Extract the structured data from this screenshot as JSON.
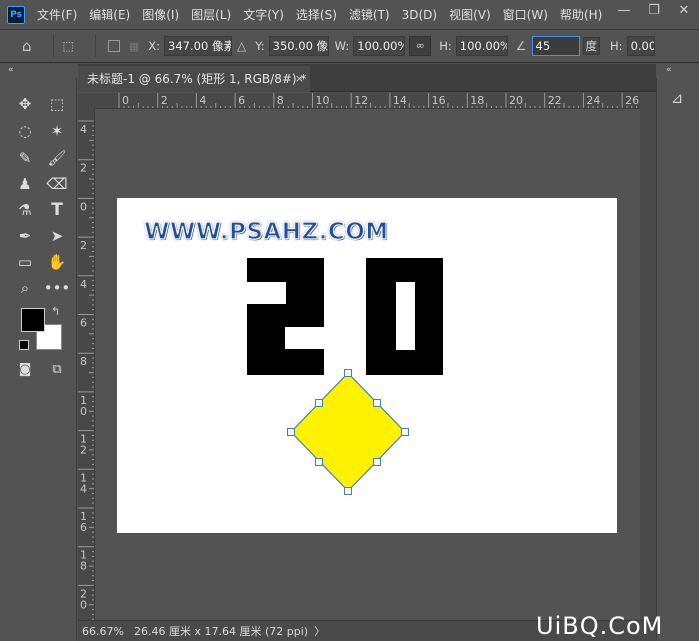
{
  "app": {
    "logo": "Ps"
  },
  "menu": [
    "文件(F)",
    "编辑(E)",
    "图像(I)",
    "图层(L)",
    "文字(Y)",
    "选择(S)",
    "滤镜(T)",
    "3D(D)",
    "视图(V)",
    "窗口(W)",
    "帮助(H)"
  ],
  "window_controls": {
    "minimize": "—",
    "restore": "❐",
    "close": "✕"
  },
  "options": {
    "x_label": "X:",
    "x_value": "347.00 像素",
    "y_label": "Y:",
    "y_value": "350.00 像素",
    "w_label": "W:",
    "w_value": "100.00%",
    "h_label": "H:",
    "h_value": "100.00%",
    "angle_value": "45",
    "angle_unit": "度",
    "h2_label": "H:",
    "h2_value": "0.00"
  },
  "panels": {
    "collapse_left": "«",
    "collapse_right": "«"
  },
  "document_tab": {
    "title": "未标题-1 @ 66.7% (矩形 1, RGB/8#) *",
    "close": "×"
  },
  "ruler_top": [
    "0",
    "2",
    "4",
    "6",
    "8",
    "10",
    "12",
    "14",
    "16",
    "18",
    "20",
    "22",
    "24",
    "26"
  ],
  "ruler_left": [
    "4",
    "2",
    "0",
    "2",
    "4",
    "6",
    "8",
    "10",
    "12",
    "14",
    "16",
    "18",
    "20"
  ],
  "canvas": {
    "watermark": "WWW.PSAHZ.COM"
  },
  "status": {
    "zoom": "66.67%",
    "doc_size": "26.46 厘米 x 17.64 厘米 (72 ppi)",
    "arrow": "〉"
  },
  "corner_logo": "UiBQ.CoM",
  "colors": {
    "foreground": "#000000",
    "background": "#ffffff",
    "shape_fill": "#fff200",
    "selection": "#3d7ebf"
  },
  "icons": [
    "move-icon",
    "marquee-icon",
    "lasso-icon",
    "magic-wand-icon",
    "eyedropper-icon",
    "brush-icon",
    "stamp-icon",
    "eraser-icon",
    "history-brush-icon",
    "type-icon",
    "pen-icon",
    "path-select-icon",
    "rectangle-icon",
    "hand-icon",
    "zoom-icon",
    "more-icon",
    "quick-mask-icon",
    "screen-mode-icon",
    "home-icon",
    "transform-icon",
    "link-icon",
    "properties-icon"
  ]
}
